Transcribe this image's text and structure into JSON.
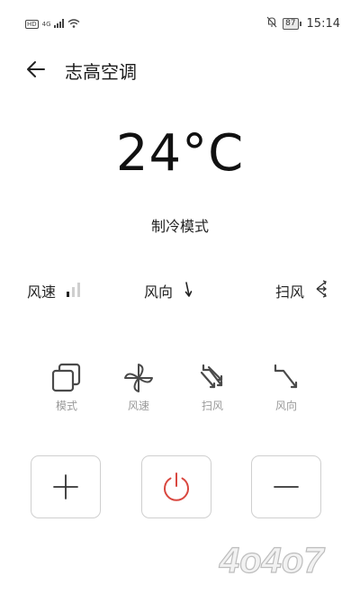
{
  "status_bar": {
    "network_badge": "HD",
    "network_type": "4G",
    "battery_level": "87",
    "time": "15:14",
    "icons": [
      "hd-icon",
      "signal-icon",
      "wifi-icon",
      "mute-bell-icon",
      "battery-icon"
    ]
  },
  "header": {
    "title": "志高空调",
    "back_icon": "arrow-left-icon"
  },
  "main": {
    "temperature": "24°C",
    "mode": "制冷模式"
  },
  "info": {
    "speed_label": "风速",
    "speed_level_fraction": 0.33,
    "direction_label": "风向",
    "swing_label": "扫风"
  },
  "functions": [
    {
      "label": "模式",
      "icon": "mode-icon"
    },
    {
      "label": "风速",
      "icon": "fan-icon"
    },
    {
      "label": "扫风",
      "icon": "swing-icon"
    },
    {
      "label": "风向",
      "icon": "direction-icon"
    }
  ],
  "controls": {
    "plus_icon": "plus-icon",
    "power_icon": "power-icon",
    "minus_icon": "minus-icon",
    "power_color": "#d9473f"
  },
  "watermark": {
    "text": "4o4o7"
  }
}
